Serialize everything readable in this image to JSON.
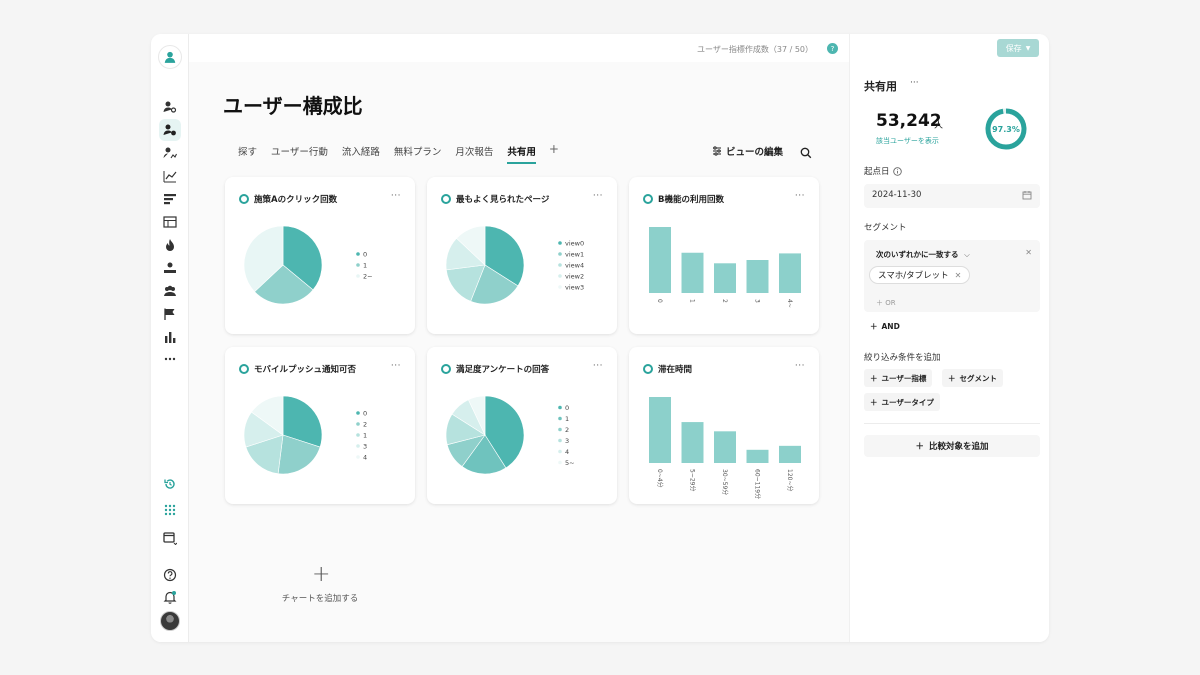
{
  "topbar": {
    "quota": "ユーザー指標作成数（37 / 50）",
    "help": "?"
  },
  "page": {
    "title": "ユーザー構成比"
  },
  "tabs": [
    {
      "label": "探す"
    },
    {
      "label": "ユーザー行動"
    },
    {
      "label": "流入経路"
    },
    {
      "label": "無料プラン"
    },
    {
      "label": "月次報告"
    },
    {
      "label": "共有用",
      "active": true
    }
  ],
  "tab_add": "+",
  "toolbar": {
    "view_edit": "ビューの編集"
  },
  "chart_data": [
    {
      "type": "pie",
      "title": "施策Aのクリック回数",
      "labels": [
        "0",
        "1",
        "2~"
      ],
      "values": [
        36,
        27,
        37
      ],
      "colors": [
        "#4db6b0",
        "#8fd0cb",
        "#e8f6f5"
      ]
    },
    {
      "type": "pie",
      "title": "最もよく見られたページ",
      "labels": [
        "view0",
        "view1",
        "view4",
        "view2",
        "view3"
      ],
      "values": [
        34,
        22,
        17,
        14,
        13
      ],
      "colors": [
        "#4db6b0",
        "#8fd0cb",
        "#b6e2de",
        "#d6efed",
        "#eef8f7"
      ]
    },
    {
      "type": "bar",
      "title": "B機能の利用回数",
      "categories": [
        "0",
        "1",
        "2",
        "3",
        "4~"
      ],
      "values": [
        100,
        61,
        45,
        50,
        60
      ],
      "ylim": [
        0,
        100
      ]
    },
    {
      "type": "pie",
      "title": "モバイルプッシュ通知可否",
      "labels": [
        "0",
        "2",
        "1",
        "3",
        "4"
      ],
      "values": [
        30,
        22,
        18,
        15,
        15
      ],
      "colors": [
        "#4db6b0",
        "#8fd0cb",
        "#b6e2de",
        "#d6efed",
        "#eef8f7"
      ]
    },
    {
      "type": "pie",
      "title": "満足度アンケートの回答",
      "labels": [
        "0",
        "1",
        "2",
        "3",
        "4",
        "5~"
      ],
      "values": [
        41,
        19,
        11,
        13,
        9,
        7
      ],
      "colors": [
        "#4db6b0",
        "#6fc3be",
        "#8fd0cb",
        "#b6e2de",
        "#d6efed",
        "#eef8f7"
      ]
    },
    {
      "type": "bar",
      "title": "滞在時間",
      "categories": [
        "0~4分",
        "5~29分",
        "30~59分",
        "60~119分",
        "120~分"
      ],
      "values": [
        100,
        62,
        48,
        20,
        26
      ],
      "ylim": [
        0,
        100
      ]
    }
  ],
  "add_chart": {
    "label": "チャートを追加する"
  },
  "panel": {
    "save": "保存",
    "title": "共有用",
    "user_count": "53,242",
    "user_unit": "人",
    "user_link": "該当ユーザーを表示",
    "ratio_label": "97.3%",
    "ratio": 0.973,
    "start_label": "起点日",
    "start_date": "2024-11-30",
    "segment_label": "セグメント",
    "segment_match": "次のいずれかに一致する",
    "segment_chip": "スマホ/タブレット",
    "or_label": "OR",
    "and_label": "AND",
    "filter_label": "絞り込み条件を追加",
    "filter_buttons": [
      "ユーザー指標",
      "セグメント",
      "ユーザータイプ"
    ],
    "compare_label": "比較対象を追加"
  },
  "colors": {
    "accent": "#2aa39c",
    "bar": "#7fcbc5"
  }
}
